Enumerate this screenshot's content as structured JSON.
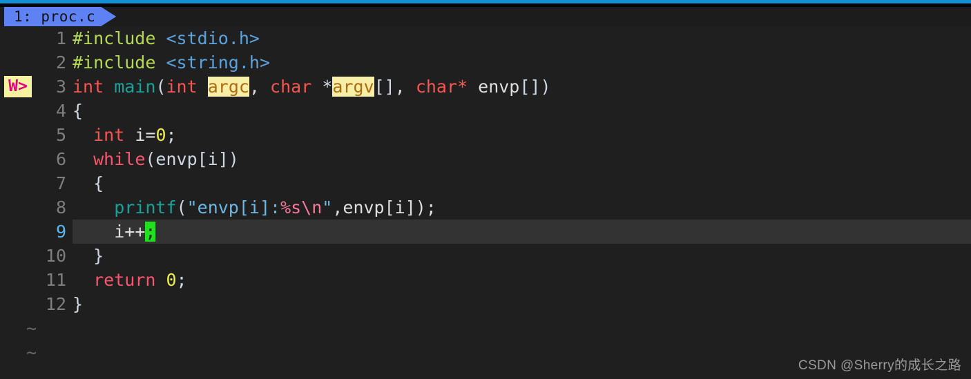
{
  "window": {
    "tab_label": "1: proc.c",
    "filename": "proc.c",
    "tab_index": "1"
  },
  "sign_column": {
    "marker_text": "W>",
    "marker_line": 3,
    "marker_fg": "#e6007e",
    "marker_bg": "#f7f3a1"
  },
  "cursor": {
    "line": 9,
    "column": 8,
    "char": ";",
    "color": "#20e020"
  },
  "colors": {
    "background": "#1f1f1f",
    "current_line_bg": "#333333",
    "tab_accent": "#5e81f4",
    "top_accent": "#1291d6",
    "linenr_fg": "#7e7e7e",
    "linenr_current_fg": "#55b9f0",
    "preproc": "#b5d94f",
    "header": "#5ba3dd",
    "type": "#f7554f",
    "function": "#17a39a",
    "keyword": "#f8566f",
    "number": "#eded4a",
    "string": "#6cb8e6",
    "escape": "#f8779a",
    "search_highlight_bg": "#f7efa8",
    "search_highlight_fg": "#b06a10"
  },
  "lines": [
    {
      "n": "1",
      "text": "#include <stdio.h>"
    },
    {
      "n": "2",
      "text": "#include <string.h>"
    },
    {
      "n": "3",
      "text": "int main(int argc, char *argv[], char* envp[])"
    },
    {
      "n": "4",
      "text": "{"
    },
    {
      "n": "5",
      "text": "  int i=0;"
    },
    {
      "n": "6",
      "text": "  while(envp[i])"
    },
    {
      "n": "7",
      "text": "  {"
    },
    {
      "n": "8",
      "text": "    printf(\"envp[i]:%s\\n\",envp[i]);"
    },
    {
      "n": "9",
      "text": "    i++;"
    },
    {
      "n": "10",
      "text": "  }"
    },
    {
      "n": "11",
      "text": "  return 0;"
    },
    {
      "n": "12",
      "text": "}"
    }
  ],
  "empty_markers": [
    "~",
    "~"
  ],
  "tokens": {
    "l1": {
      "pre": "#include",
      "space": " ",
      "hdr": "<stdio.h>"
    },
    "l2": {
      "pre": "#include",
      "space": " ",
      "hdr": "<string.h>"
    },
    "l3": {
      "int1": "int",
      "sp1": " ",
      "main": "main",
      "p1": "(",
      "int2": "int",
      "sp2": " ",
      "argc": "argc",
      "comma1": ", ",
      "char1": "char",
      "sp3": " ",
      "star1": "*",
      "argv": "argv",
      "brk1": "[]",
      "comma2": ", ",
      "char2": "char*",
      "sp4": " ",
      "envp": "envp",
      "brk2": "[]",
      "p2": ")"
    },
    "l4": {
      "brace": "{"
    },
    "l5": {
      "indent": "  ",
      "int": "int",
      "sp": " ",
      "var": "i=",
      "num": "0",
      "semi": ";"
    },
    "l6": {
      "indent": "  ",
      "kw": "while",
      "rest": "(envp[i])"
    },
    "l7": {
      "indent": "  ",
      "brace": "{"
    },
    "l8": {
      "indent": "    ",
      "fn": "printf",
      "p1": "(",
      "q1": "\"envp[i]:",
      "esc1": "%s",
      "esc2": "\\n",
      "q2": "\"",
      "rest": ",envp[i]);"
    },
    "l9": {
      "indent": "    ",
      "code": "i++",
      "cursor": ";"
    },
    "l10": {
      "indent": "  ",
      "brace": "}"
    },
    "l11": {
      "indent": "  ",
      "kw": "return",
      "sp": " ",
      "num": "0",
      "semi": ";"
    },
    "l12": {
      "brace": "}"
    }
  },
  "watermark": "CSDN @Sherry的成长之路"
}
